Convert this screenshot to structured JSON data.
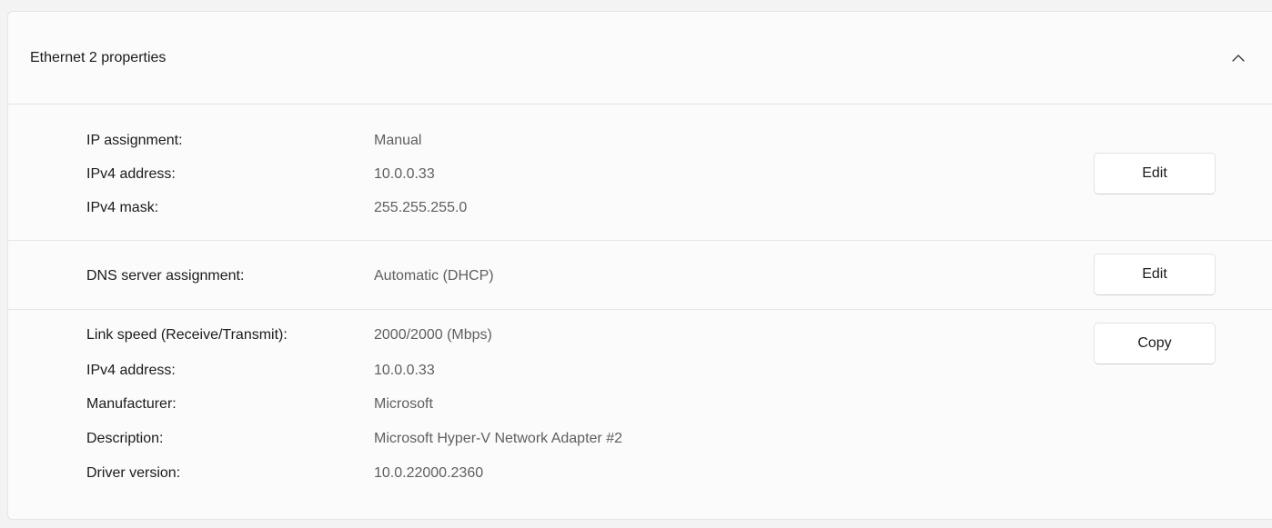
{
  "header": {
    "title": "Ethernet 2 properties",
    "collapse_icon": "chevron-up-icon"
  },
  "ip_section": {
    "rows": [
      {
        "label": "IP assignment:",
        "value": "Manual"
      },
      {
        "label": "IPv4 address:",
        "value": "10.0.0.33"
      },
      {
        "label": "IPv4 mask:",
        "value": "255.255.255.0"
      }
    ],
    "edit_label": "Edit"
  },
  "dns_section": {
    "rows": [
      {
        "label": "DNS server assignment:",
        "value": "Automatic (DHCP)"
      }
    ],
    "edit_label": "Edit"
  },
  "details_section": {
    "rows": [
      {
        "label": "Link speed (Receive/Transmit):",
        "value": "2000/2000 (Mbps)"
      },
      {
        "label": "IPv4 address:",
        "value": "10.0.0.33"
      },
      {
        "label": "Manufacturer:",
        "value": "Microsoft"
      },
      {
        "label": "Description:",
        "value": "Microsoft Hyper-V Network Adapter #2"
      },
      {
        "label": "Driver version:",
        "value": "10.0.22000.2360"
      }
    ],
    "copy_label": "Copy"
  }
}
